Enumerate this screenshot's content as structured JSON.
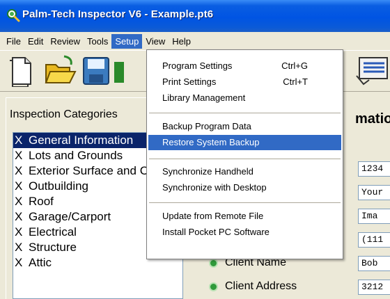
{
  "window": {
    "title": "Palm-Tech Inspector V6 - Example.pt6"
  },
  "menubar": {
    "items": [
      "File",
      "Edit",
      "Review",
      "Tools",
      "Setup",
      "View",
      "Help"
    ]
  },
  "setup_menu": {
    "groups": [
      [
        {
          "label": "Program Settings",
          "shortcut": "Ctrl+G"
        },
        {
          "label": "Print Settings",
          "shortcut": "Ctrl+T"
        },
        {
          "label": "Library Management",
          "shortcut": ""
        }
      ],
      [
        {
          "label": "Backup Program Data",
          "shortcut": ""
        },
        {
          "label": "Restore System Backup",
          "shortcut": "",
          "highlighted": true
        }
      ],
      [
        {
          "label": "Synchronize Handheld",
          "shortcut": ""
        },
        {
          "label": "Synchronize with Desktop",
          "shortcut": ""
        }
      ],
      [
        {
          "label": "Update from Remote File",
          "shortcut": ""
        },
        {
          "label": "Install Pocket PC Software",
          "shortcut": ""
        }
      ]
    ]
  },
  "left_panel": {
    "heading": "Inspection Categories",
    "items": [
      {
        "mark": "X",
        "label": "General Information",
        "selected": true
      },
      {
        "mark": "X",
        "label": "Lots and Grounds"
      },
      {
        "mark": "X",
        "label": "Exterior Surface and Components"
      },
      {
        "mark": "X",
        "label": "Outbuilding"
      },
      {
        "mark": "X",
        "label": "Roof"
      },
      {
        "mark": "X",
        "label": "Garage/Carport"
      },
      {
        "mark": "X",
        "label": "Electrical"
      },
      {
        "mark": "X",
        "label": "Structure"
      },
      {
        "mark": "X",
        "label": "Attic"
      }
    ]
  },
  "right_panel": {
    "heading": "matio",
    "fields": [
      {
        "label": "",
        "value": "1234"
      },
      {
        "label": "",
        "value": "Your"
      },
      {
        "label": "",
        "value": "Ima"
      },
      {
        "label": "",
        "value": "(111"
      },
      {
        "label": "Client Name",
        "value": "Bob"
      },
      {
        "label": "Client Address",
        "value": "3212"
      }
    ]
  },
  "colors": {
    "titlebar": "#0054e3",
    "menu_highlight": "#316ac5",
    "list_selection": "#0a246a",
    "bullet": "#2f9a3a"
  }
}
